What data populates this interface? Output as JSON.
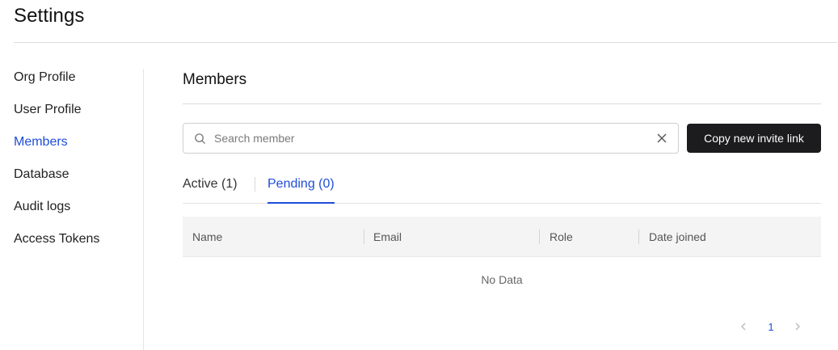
{
  "header": {
    "title": "Settings"
  },
  "sidebar": {
    "items": [
      {
        "label": "Org Profile"
      },
      {
        "label": "User Profile"
      },
      {
        "label": "Members"
      },
      {
        "label": "Database"
      },
      {
        "label": "Audit logs"
      },
      {
        "label": "Access Tokens"
      }
    ],
    "active_index": 2
  },
  "main": {
    "title": "Members",
    "search": {
      "placeholder": "Search member",
      "value": ""
    },
    "invite_button": "Copy new invite link",
    "tabs": [
      {
        "label": "Active (1)"
      },
      {
        "label": "Pending (0)"
      }
    ],
    "active_tab": 1,
    "table": {
      "columns": [
        "Name",
        "Email",
        "Role",
        "Date joined"
      ],
      "rows": [],
      "empty_text": "No Data"
    },
    "pagination": {
      "current_page": "1"
    }
  },
  "colors": {
    "accent": "#1f4ed8",
    "button_bg": "#1c1c1e",
    "header_bg": "#f4f4f5"
  }
}
